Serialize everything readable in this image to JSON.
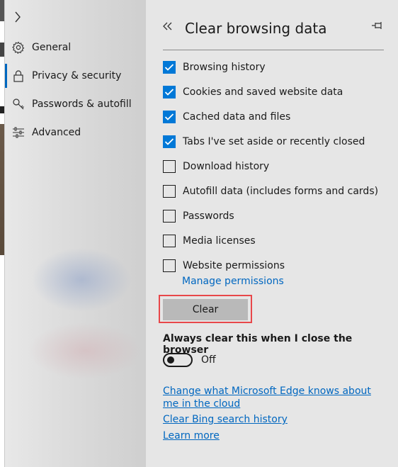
{
  "sidebar": {
    "items": [
      {
        "label": "General",
        "icon": "gear-icon"
      },
      {
        "label": "Privacy & security",
        "icon": "lock-icon",
        "active": true
      },
      {
        "label": "Passwords & autofill",
        "icon": "key-icon"
      },
      {
        "label": "Advanced",
        "icon": "sliders-icon"
      }
    ]
  },
  "panel": {
    "title": "Clear browsing data",
    "checkboxes": [
      {
        "label": "Browsing history",
        "checked": true
      },
      {
        "label": "Cookies and saved website data",
        "checked": true
      },
      {
        "label": "Cached data and files",
        "checked": true
      },
      {
        "label": "Tabs I've set aside or recently closed",
        "checked": true
      },
      {
        "label": "Download history",
        "checked": false
      },
      {
        "label": "Autofill data (includes forms and cards)",
        "checked": false
      },
      {
        "label": "Passwords",
        "checked": false
      },
      {
        "label": "Media licenses",
        "checked": false
      },
      {
        "label": "Website permissions",
        "checked": false
      }
    ],
    "manage_permissions": "Manage permissions",
    "clear_button": "Clear",
    "always_clear_label": "Always clear this when I close the browser",
    "toggle_state": "Off",
    "links": [
      "Change what Microsoft Edge knows about me in the cloud",
      "Clear Bing search history",
      "Learn more"
    ]
  },
  "colors": {
    "accent": "#0078d7",
    "link": "#0067c0",
    "highlight": "#e8474a",
    "panel_bg": "#e6e6e6"
  }
}
